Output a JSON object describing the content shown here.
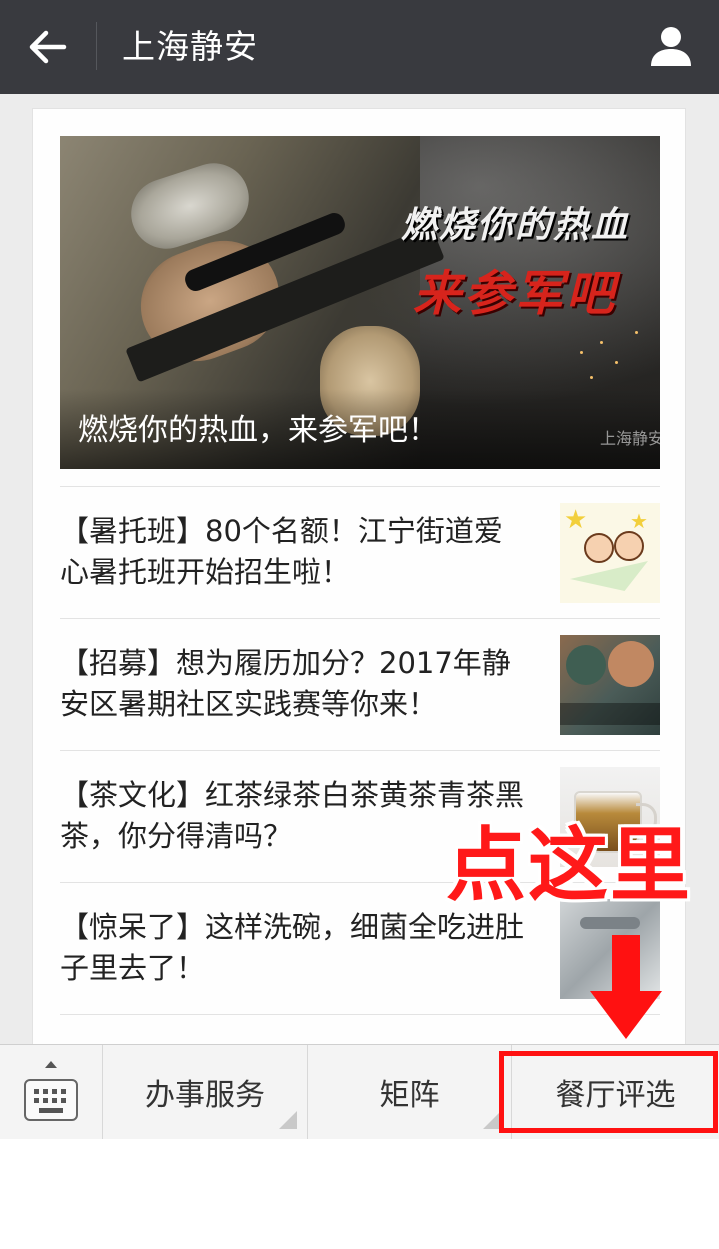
{
  "header": {
    "title": "上海静安"
  },
  "article": {
    "caption": "燃烧你的热血，来参军吧！",
    "slogan_line1": "燃烧你的热血",
    "slogan_line2": "来参军吧",
    "watermark": "上海静安"
  },
  "news": [
    {
      "title": "【暑托班】80个名额！江宁街道爱心暑托班开始招生啦！"
    },
    {
      "title": "【招募】想为履历加分？2017年静安区暑期社区实践赛等你来！"
    },
    {
      "title": "【茶文化】红茶绿茶白茶黄茶青茶黑茶，你分得清吗？"
    },
    {
      "title": "【惊呆了】这样洗碗，细菌全吃进肚子里去了！"
    }
  ],
  "annotation": {
    "text": "点这里",
    "color": "#ff1919"
  },
  "menu": {
    "items": [
      {
        "label": "办事服务"
      },
      {
        "label": "矩阵"
      },
      {
        "label": "餐厅评选"
      }
    ]
  },
  "colors": {
    "topbar": "#393a3f",
    "background": "#ececec",
    "highlight": "#ff1111"
  },
  "icons": {
    "back": "arrow-left-icon",
    "profile": "person-icon",
    "keyboard": "keyboard-icon"
  }
}
